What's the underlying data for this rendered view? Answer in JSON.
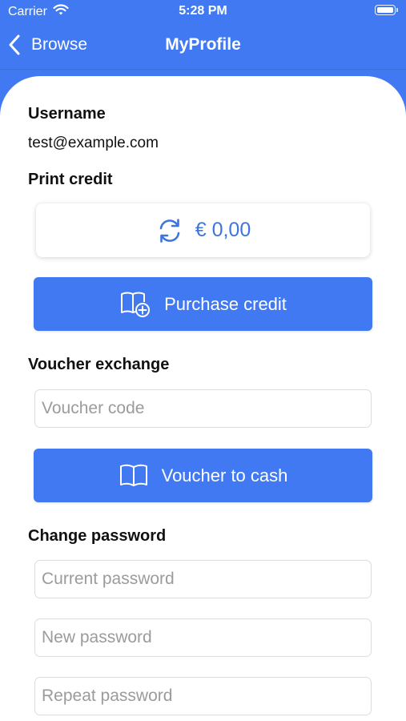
{
  "status_bar": {
    "carrier": "Carrier",
    "time": "5:28 PM",
    "icons": [
      "wifi-icon",
      "battery-icon"
    ]
  },
  "nav": {
    "back_label": "Browse",
    "title": "MyProfile",
    "icons": [
      "chevron-left-icon"
    ]
  },
  "profile": {
    "username_label": "Username",
    "username_value": "test@example.com",
    "print_credit_label": "Print credit",
    "credit_amount": "€ 0,00",
    "credit_icon": "refresh-icon",
    "purchase_label": "Purchase credit",
    "purchase_icon": "book-plus-icon"
  },
  "voucher": {
    "section_label": "Voucher exchange",
    "code_placeholder": "Voucher code",
    "code_value": "",
    "button_label": "Voucher to cash",
    "button_icon": "book-open-icon"
  },
  "password": {
    "section_label": "Change password",
    "current_placeholder": "Current password",
    "new_placeholder": "New password",
    "repeat_placeholder": "Repeat password"
  },
  "colors": {
    "brand": "#4179f2",
    "accent_text": "#3f74e0",
    "placeholder": "#9b9b9b"
  }
}
